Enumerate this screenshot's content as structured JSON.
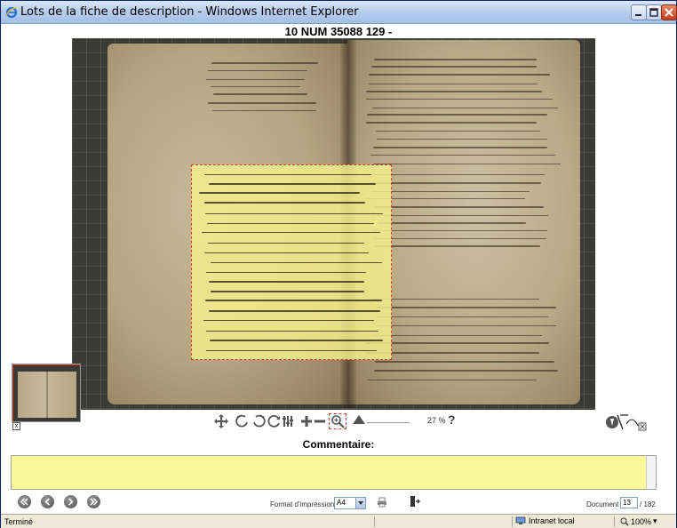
{
  "window": {
    "title": "Lots de la fiche de description - Windows Internet Explorer",
    "buttons": [
      "minimize",
      "maximize",
      "close"
    ]
  },
  "document_title": "10 NUM 35088 129 -",
  "toolbar": {
    "tools": [
      "move-icon",
      "rotate-left-icon",
      "rotate-right-icon",
      "adjust-icon",
      "zoom-in-icon",
      "zoom-out-icon",
      "zoom-select-icon"
    ],
    "zoom_percent": "27 %",
    "help": "?"
  },
  "comment": {
    "label": "Commentaire:",
    "value": ""
  },
  "nav": {
    "buttons": [
      "first-page",
      "previous-page",
      "next-page",
      "last-page"
    ]
  },
  "print": {
    "format_label": "Format d'impression:",
    "format_value": "A4"
  },
  "document": {
    "label": "Document",
    "current": "13",
    "total": "/ 182"
  },
  "status": {
    "text": "Terminé",
    "zone": "Intranet local",
    "zoom": "100%"
  },
  "colors": {
    "selection": "#f6f08c",
    "selection_border": "#d23a2a",
    "comment_bg": "#fbfa9a"
  }
}
